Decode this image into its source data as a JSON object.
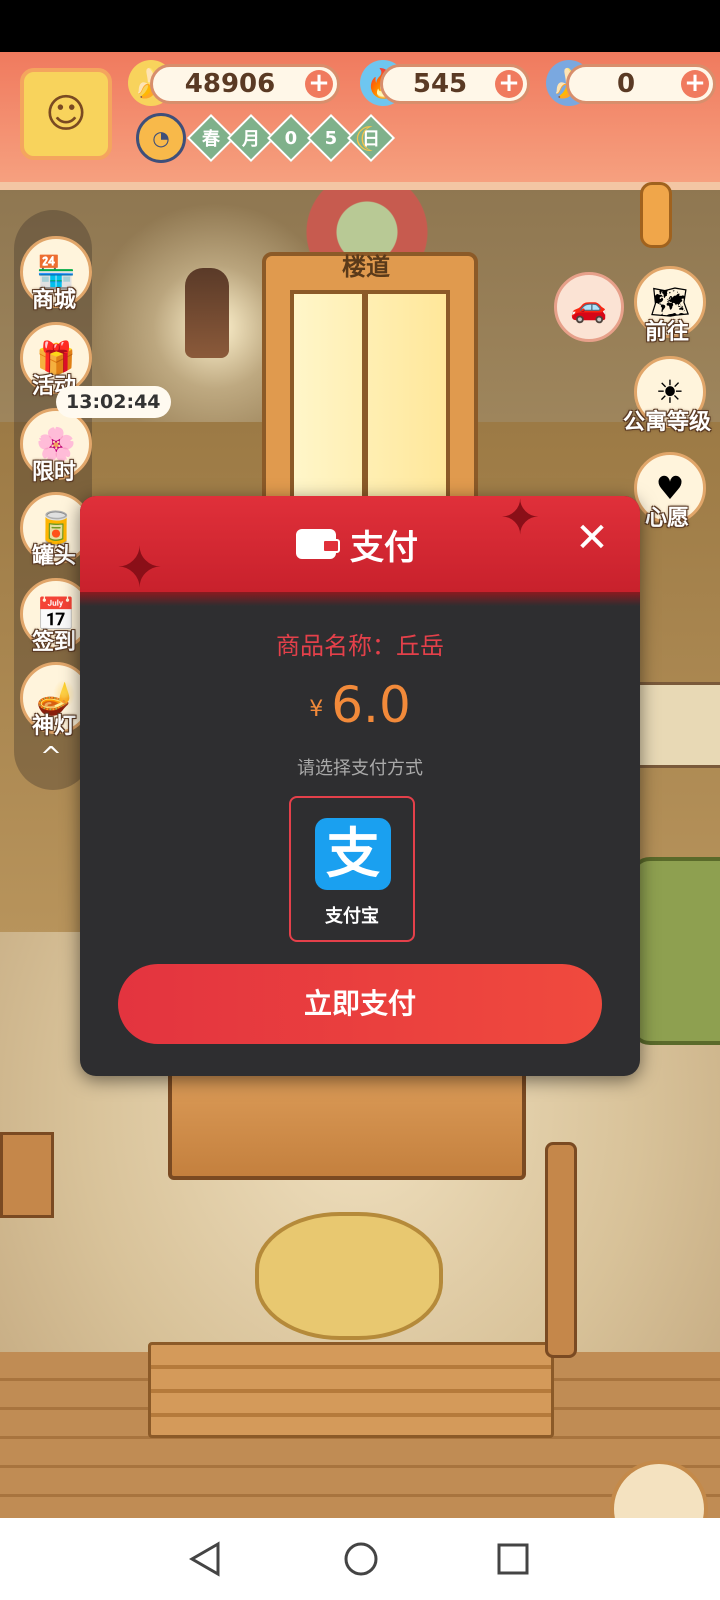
{
  "hud": {
    "currencies": [
      {
        "name": "banana",
        "value": "48906"
      },
      {
        "name": "blue-flame",
        "value": "545"
      },
      {
        "name": "blue-banana",
        "value": "0"
      }
    ],
    "plus": "+",
    "date_chars": [
      "春",
      "月",
      "0",
      "5",
      "日"
    ]
  },
  "room": {
    "door_sign": "楼道"
  },
  "left_menu": {
    "items": [
      {
        "label": "商城",
        "icon": "shop-icon"
      },
      {
        "label": "活动",
        "icon": "gift-icon"
      },
      {
        "label": "限时",
        "icon": "limited-icon"
      },
      {
        "label": "罐头",
        "icon": "can-icon"
      },
      {
        "label": "签到",
        "icon": "checkin-icon"
      },
      {
        "label": "神灯",
        "icon": "lamp-icon"
      }
    ],
    "timer": "13:02:44",
    "collapse": "^"
  },
  "right_menu": {
    "items": [
      {
        "label": "前往",
        "icon": "map-icon"
      },
      {
        "label": "公寓等级",
        "icon": "sun-icon"
      },
      {
        "label": "心愿",
        "icon": "heart-icon"
      }
    ]
  },
  "dialog": {
    "title": "支付",
    "close": "✕",
    "product_line": "商品名称：丘岳",
    "currency_symbol": "¥",
    "amount": "6.0",
    "hint": "请选择支付方式",
    "method_logo": "支",
    "method_label": "支付宝",
    "pay_button": "立即支付",
    "colors": {
      "header": "#d8262f",
      "body": "#2e2e30",
      "price": "#f28a3a",
      "button": "#e83a3e"
    }
  }
}
